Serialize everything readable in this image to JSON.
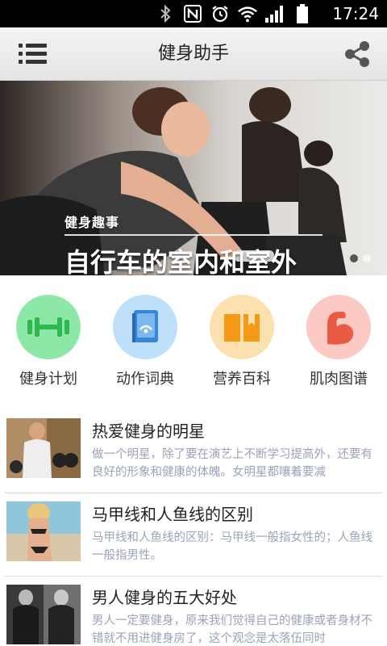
{
  "status_bar": {
    "time": "17:24",
    "icons": [
      "bluetooth-icon",
      "nfc-icon",
      "alarm-icon",
      "wifi-icon",
      "signal-icon",
      "battery-icon"
    ]
  },
  "app_bar": {
    "title": "健身助手",
    "menu_icon": "list-menu-icon",
    "share_icon": "share-icon"
  },
  "banner": {
    "tag": "健身趣事",
    "headline": "自行车的室内和室外",
    "slides": 2,
    "active_slide": 1
  },
  "categories": [
    {
      "label": "健身计划",
      "icon": "dumbbell-icon",
      "color": "#8de8a8",
      "icon_color": "#2fb84f"
    },
    {
      "label": "动作词典",
      "icon": "book-icon",
      "color": "#bfe0fb",
      "icon_color": "#3a86d6"
    },
    {
      "label": "营养百科",
      "icon": "open-book-icon",
      "color": "#fde0b0",
      "icon_color": "#f59a17"
    },
    {
      "label": "肌肉图谱",
      "icon": "bicep-icon",
      "color": "#fcc9c3",
      "icon_color": "#ea5b45"
    }
  ],
  "articles": [
    {
      "title": "热爱健身的明星",
      "desc": "做一个明星，除了要在演艺上不断学习提高外，还要有良好的形象和健康的体魄。女明星都嚷着要减"
    },
    {
      "title": "马甲线和人鱼线的区别",
      "desc": "马甲线和人鱼线的区别：马甲线一般指女性的；人鱼线一般指男性。"
    },
    {
      "title": "男人健身的五大好处",
      "desc": "男人一定要健身，原来我们觉得自己的健康或者身材不错就不用进健身房了，这个观念是太落伍同时"
    }
  ]
}
